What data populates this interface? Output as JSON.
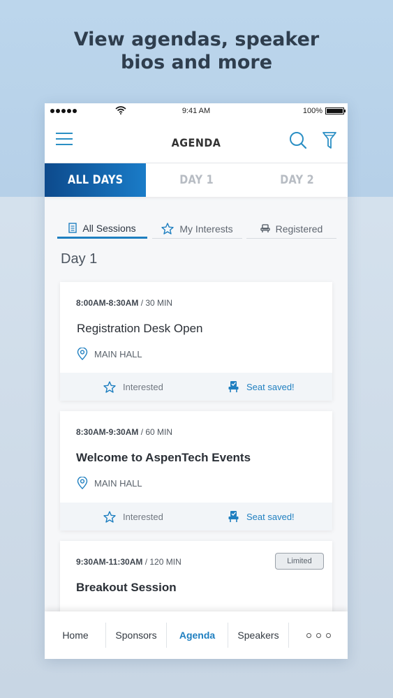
{
  "headline": {
    "line1": "View agendas, speaker",
    "line2": "bios and more"
  },
  "status_bar": {
    "time": "9:41 AM",
    "battery": "100%"
  },
  "nav": {
    "title": "AGENDA"
  },
  "day_tabs": [
    {
      "label": "ALL DAYS",
      "active": true
    },
    {
      "label": "DAY 1",
      "active": false
    },
    {
      "label": "DAY 2",
      "active": false
    }
  ],
  "sub_tabs": [
    {
      "label": "All Sessions",
      "icon": "document-icon",
      "active": true
    },
    {
      "label": "My Interests",
      "icon": "star-icon",
      "active": false
    },
    {
      "label": "Registered",
      "icon": "seat-icon",
      "active": false
    }
  ],
  "day_heading": "Day 1",
  "sessions": [
    {
      "time": "8:00AM-8:30AM",
      "duration": "/ 30 MIN",
      "title": "Registration Desk Open",
      "location": "MAIN HALL",
      "interested_label": "Interested",
      "seat_label": "Seat saved!"
    },
    {
      "time": "8:30AM-9:30AM",
      "duration": "/ 60 MIN",
      "title": "Welcome to AspenTech Events",
      "location": "MAIN HALL",
      "interested_label": "Interested",
      "seat_label": "Seat saved!"
    },
    {
      "time": "9:30AM-11:30AM",
      "duration": "/ 120 MIN",
      "title": "Breakout Session",
      "badge": "Limited"
    }
  ],
  "bottom_nav": [
    {
      "label": "Home",
      "active": false
    },
    {
      "label": "Sponsors",
      "active": false
    },
    {
      "label": "Agenda",
      "active": true
    },
    {
      "label": "Speakers",
      "active": false
    }
  ],
  "colors": {
    "accent": "#1f7fc0",
    "tab_gradient_start": "#0d4a8c",
    "tab_gradient_end": "#1a7cc8"
  }
}
